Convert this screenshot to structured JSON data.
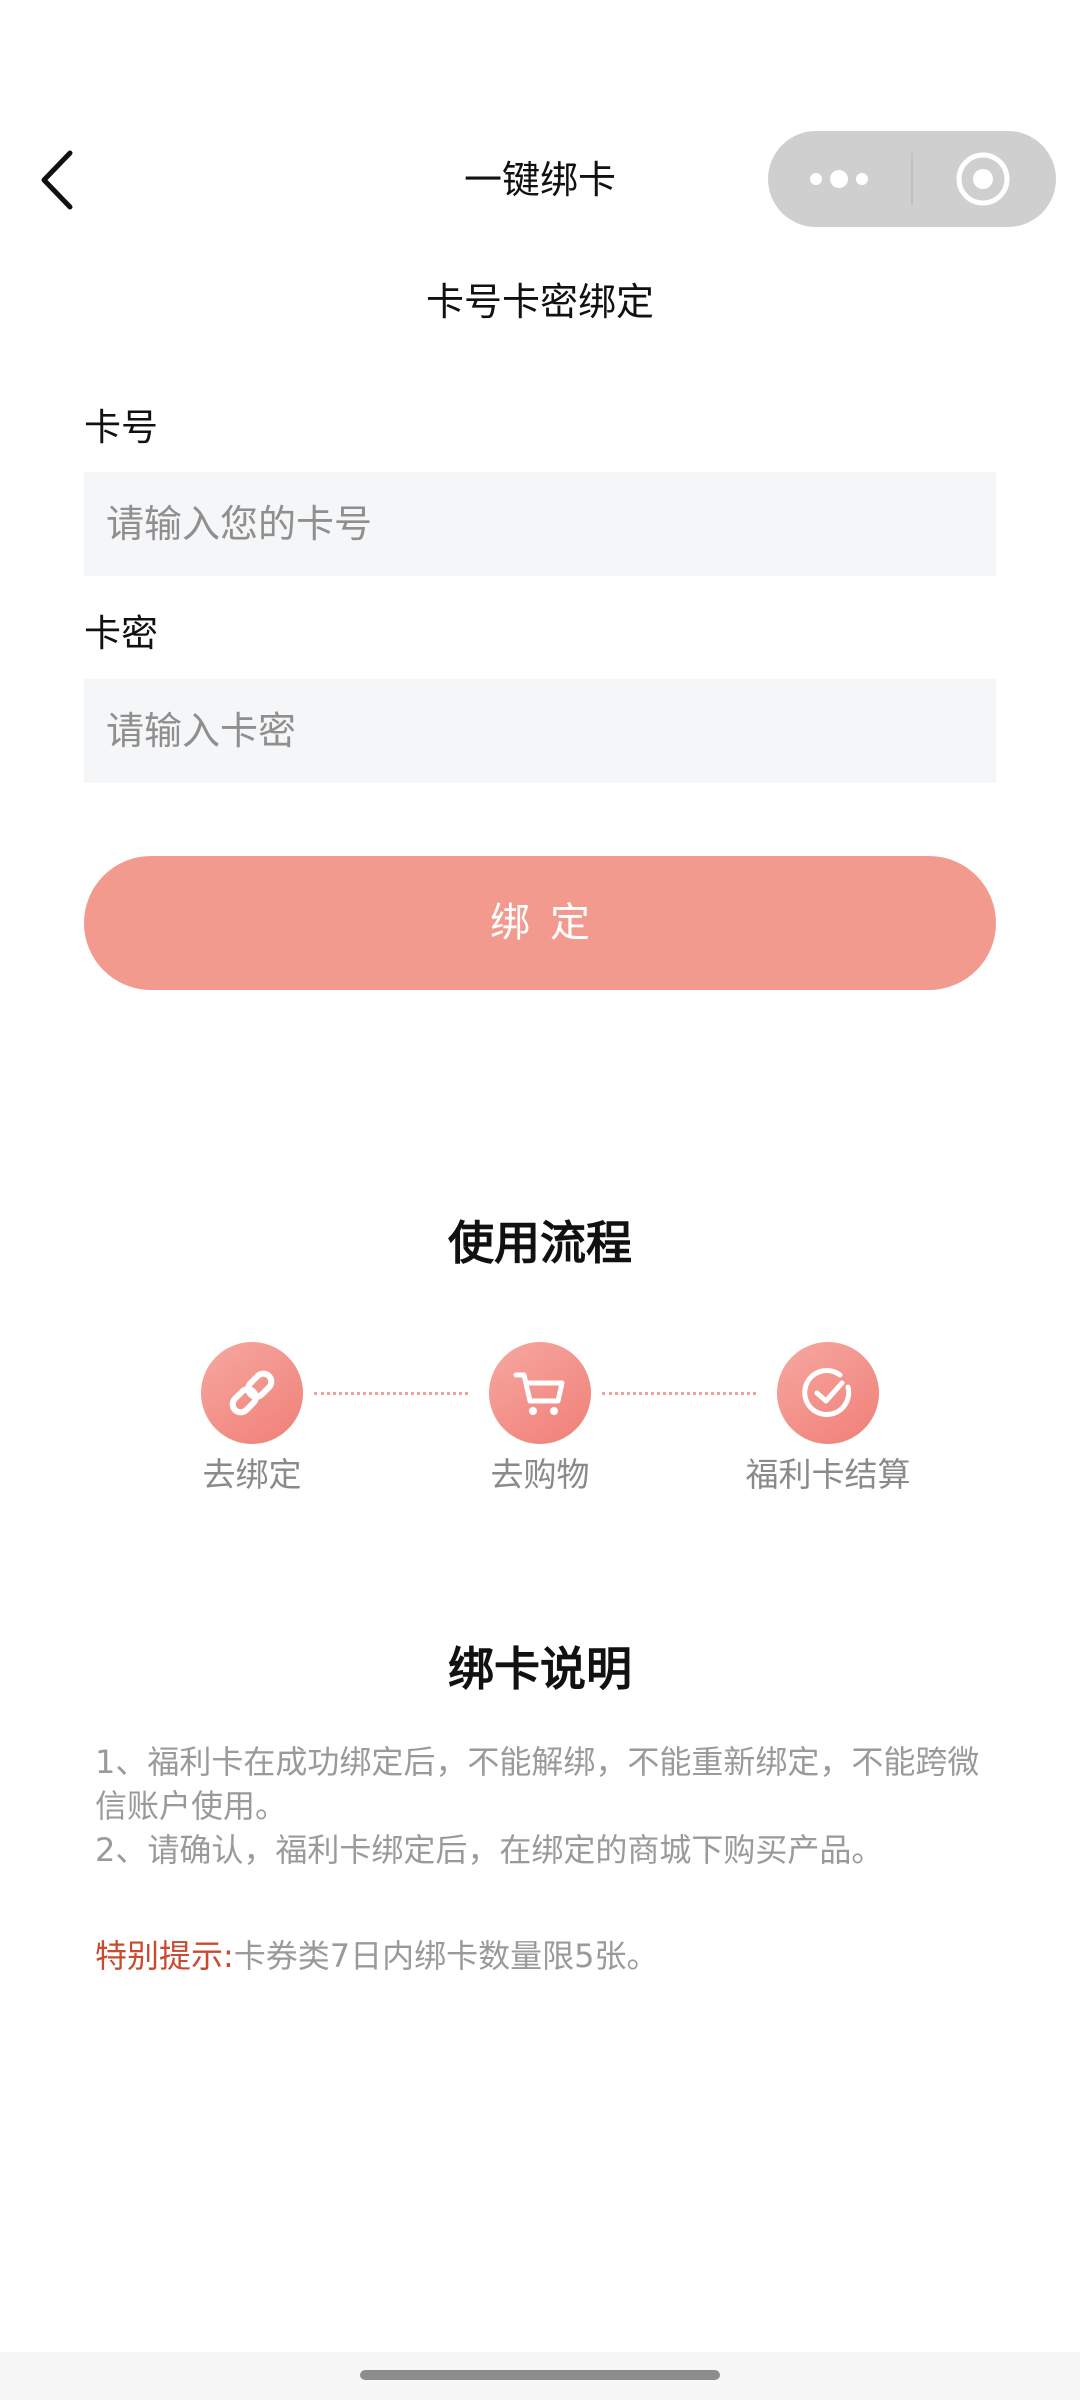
{
  "nav": {
    "title": "一键绑卡"
  },
  "form": {
    "subtitle": "卡号卡密绑定",
    "card_number": {
      "label": "卡号",
      "placeholder": "请输入您的卡号",
      "value": ""
    },
    "card_password": {
      "label": "卡密",
      "placeholder": "请输入卡密",
      "value": ""
    },
    "bind_button_label": "绑定"
  },
  "process": {
    "title": "使用流程",
    "steps": [
      {
        "label": "去绑定",
        "icon": "link-icon"
      },
      {
        "label": "去购物",
        "icon": "shopping-cart-icon"
      },
      {
        "label": "福利卡结算",
        "icon": "check-circle-icon"
      }
    ]
  },
  "instructions": {
    "title": "绑卡说明",
    "rules": [
      "1、福利卡在成功绑定后，不能解绑，不能重新绑定，不能跨微信账户使用。",
      "2、请确认，福利卡绑定后，在绑定的商城下购买产品。"
    ],
    "notice_label": "特别提示:",
    "notice_text": "卡券类7日内绑卡数量限5张。"
  },
  "colors": {
    "accent": "#f39a8f",
    "notice": "#c94a2f",
    "input_bg": "#f5f6f7",
    "muted_text": "#9a9a9a"
  }
}
